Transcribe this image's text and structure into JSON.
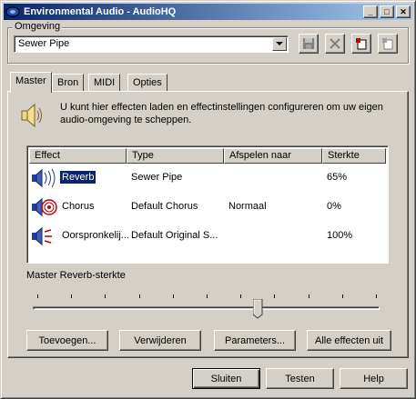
{
  "window": {
    "title": "Environmental Audio - AudioHQ"
  },
  "titlebar_buttons": {
    "minimize": "_",
    "maximize": "□",
    "close": "✕"
  },
  "environment": {
    "group_label": "Omgeving",
    "selected": "Sewer Pipe"
  },
  "toolbar_icons": [
    "save-icon",
    "delete-icon",
    "new-icon",
    "properties-icon"
  ],
  "tabs": [
    {
      "label": "Master",
      "active": true
    },
    {
      "label": "Bron",
      "active": false
    },
    {
      "label": "MIDI",
      "active": false
    },
    {
      "label": "Opties",
      "active": false
    }
  ],
  "info_text": "U kunt hier effecten laden en effectinstellingen configureren om uw eigen audio-omgeving te scheppen.",
  "list": {
    "columns": [
      "Effect",
      "Type",
      "Afspelen naar",
      "Sterkte"
    ],
    "rows": [
      {
        "effect": "Reverb",
        "type": "Sewer Pipe",
        "play_to": "",
        "strength": "65%",
        "selected": true
      },
      {
        "effect": "Chorus",
        "type": "Default Chorus",
        "play_to": "Normaal",
        "strength": "0%",
        "selected": false
      },
      {
        "effect": "Oorspronkelij...",
        "type": "Default Original S...",
        "play_to": "",
        "strength": "100%",
        "selected": false
      }
    ]
  },
  "slider": {
    "label": "Master Reverb-sterkte",
    "value_fraction": 0.65,
    "tick_count": 11
  },
  "buttons": {
    "add": "Toevoegen...",
    "remove": "Verwijderen",
    "parameters": "Parameters...",
    "all_off": "Alle effecten uit",
    "close": "Sluiten",
    "test": "Testen",
    "help": "Help"
  },
  "colors": {
    "title_start": "#0a246a",
    "title_end": "#a6caf0",
    "selection": "#0a246a",
    "face": "#d4d0c8"
  }
}
